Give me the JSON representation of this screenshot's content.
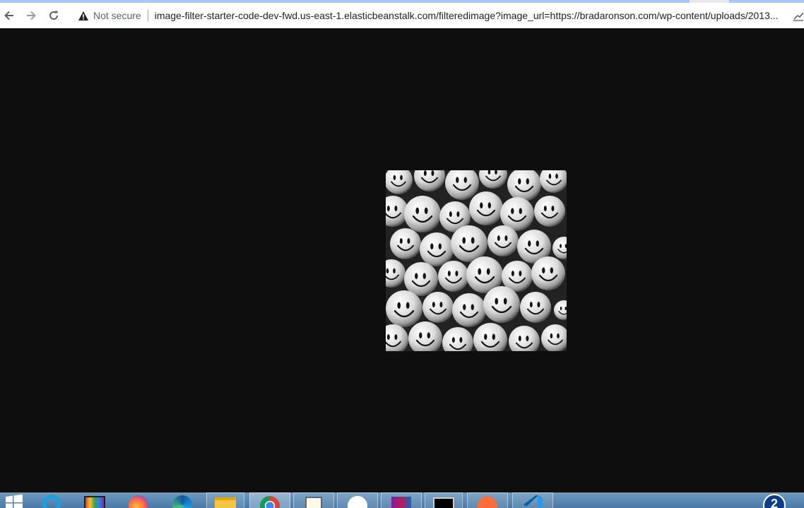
{
  "browser": {
    "security_label": "Not secure",
    "url": "image-filter-starter-code-dev-fwd.us-east-1.elasticbeanstalk.com/filteredimage?image_url=https://bradaronson.com/wp-content/uploads/2013..."
  },
  "icons": {
    "back": "back-arrow-icon",
    "forward": "forward-arrow-icon",
    "reload": "reload-icon",
    "warning": "warning-triangle-icon"
  },
  "colors": {
    "page_background": "#0e0e0e",
    "toolbar": "#ffffff",
    "tab_strip": "#a8c7fa",
    "taskbar": "#5a88b4"
  },
  "taskbar": {
    "apps": [
      "start",
      "internet-explorer",
      "photo-app",
      "firefox",
      "edge",
      "file-explorer",
      "chrome",
      "notepad-plus-plus",
      "slack",
      "winrar",
      "command-prompt",
      "postman",
      "vscode"
    ],
    "tray_badge": "2"
  }
}
